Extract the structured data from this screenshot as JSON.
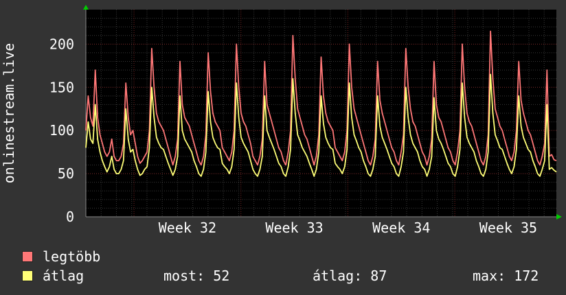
{
  "chart_data": {
    "type": "line",
    "ylabel": "onlinestream.live",
    "ylim": [
      0,
      240
    ],
    "y_ticks": [
      0,
      50,
      100,
      150,
      200
    ],
    "x_tick_labels": [
      "Week 32",
      "Week 33",
      "Week 34",
      "Week 35"
    ],
    "grid": true,
    "legend_placement": "bottom-left",
    "background_color": "#333333",
    "plot_background": "#000000",
    "series": [
      {
        "name": "legtöbb",
        "color": "#ff7777",
        "values": [
          100,
          140,
          115,
          105,
          170,
          115,
          95,
          85,
          75,
          70,
          75,
          90,
          70,
          65,
          65,
          70,
          85,
          155,
          115,
          95,
          100,
          85,
          70,
          62,
          65,
          70,
          75,
          100,
          195,
          150,
          120,
          110,
          105,
          100,
          90,
          80,
          70,
          60,
          70,
          90,
          180,
          130,
          115,
          110,
          105,
          95,
          85,
          75,
          65,
          60,
          70,
          95,
          190,
          145,
          120,
          110,
          105,
          100,
          80,
          75,
          70,
          65,
          75,
          100,
          200,
          150,
          120,
          110,
          105,
          95,
          85,
          70,
          65,
          60,
          70,
          90,
          180,
          130,
          120,
          110,
          100,
          90,
          80,
          75,
          65,
          60,
          75,
          100,
          210,
          160,
          125,
          115,
          105,
          95,
          90,
          80,
          70,
          60,
          70,
          95,
          185,
          140,
          120,
          110,
          105,
          100,
          80,
          75,
          70,
          65,
          75,
          100,
          200,
          150,
          125,
          115,
          105,
          95,
          85,
          75,
          65,
          60,
          70,
          90,
          180,
          135,
          120,
          110,
          100,
          90,
          80,
          75,
          65,
          60,
          75,
          95,
          195,
          150,
          125,
          110,
          105,
          95,
          85,
          75,
          70,
          60,
          70,
          90,
          180,
          130,
          115,
          110,
          100,
          90,
          80,
          75,
          65,
          60,
          75,
          100,
          200,
          150,
          120,
          110,
          105,
          95,
          85,
          75,
          65,
          60,
          70,
          95,
          215,
          160,
          125,
          115,
          105,
          100,
          90,
          80,
          70,
          65,
          75,
          100,
          180,
          135,
          120,
          110,
          100,
          95,
          85,
          75,
          65,
          60,
          70,
          85,
          170,
          70,
          72,
          66,
          65
        ]
      },
      {
        "name": "átlag",
        "color": "#ffff77",
        "values": [
          80,
          110,
          90,
          85,
          130,
          90,
          75,
          65,
          58,
          52,
          58,
          70,
          55,
          50,
          50,
          55,
          65,
          125,
          90,
          75,
          78,
          65,
          55,
          48,
          50,
          55,
          58,
          80,
          150,
          115,
          92,
          85,
          80,
          78,
          70,
          62,
          55,
          48,
          55,
          70,
          140,
          100,
          90,
          85,
          80,
          75,
          65,
          58,
          50,
          47,
          55,
          75,
          145,
          110,
          92,
          85,
          80,
          78,
          62,
          58,
          55,
          50,
          58,
          78,
          155,
          115,
          92,
          85,
          80,
          75,
          65,
          55,
          50,
          47,
          55,
          70,
          140,
          100,
          92,
          85,
          78,
          70,
          62,
          58,
          50,
          47,
          58,
          78,
          160,
          120,
          95,
          88,
          80,
          75,
          70,
          62,
          55,
          47,
          55,
          75,
          140,
          108,
          92,
          85,
          80,
          78,
          62,
          58,
          55,
          50,
          58,
          78,
          155,
          115,
          95,
          88,
          80,
          75,
          65,
          58,
          50,
          47,
          55,
          70,
          140,
          105,
          92,
          85,
          78,
          70,
          62,
          58,
          50,
          47,
          58,
          75,
          150,
          115,
          95,
          85,
          80,
          75,
          65,
          58,
          55,
          47,
          55,
          70,
          138,
          100,
          90,
          85,
          78,
          70,
          62,
          58,
          50,
          47,
          58,
          78,
          155,
          115,
          92,
          85,
          80,
          75,
          65,
          58,
          50,
          47,
          55,
          75,
          165,
          120,
          95,
          88,
          80,
          78,
          70,
          62,
          55,
          50,
          58,
          78,
          140,
          105,
          92,
          85,
          78,
          75,
          65,
          58,
          50,
          47,
          55,
          65,
          130,
          55,
          57,
          54,
          52
        ]
      }
    ]
  },
  "legend": {
    "max_label": "legtöbb",
    "avg_label": "átlag",
    "stats": {
      "now": "most: 52",
      "avg": "átlag: 87",
      "max": "max: 172"
    }
  }
}
